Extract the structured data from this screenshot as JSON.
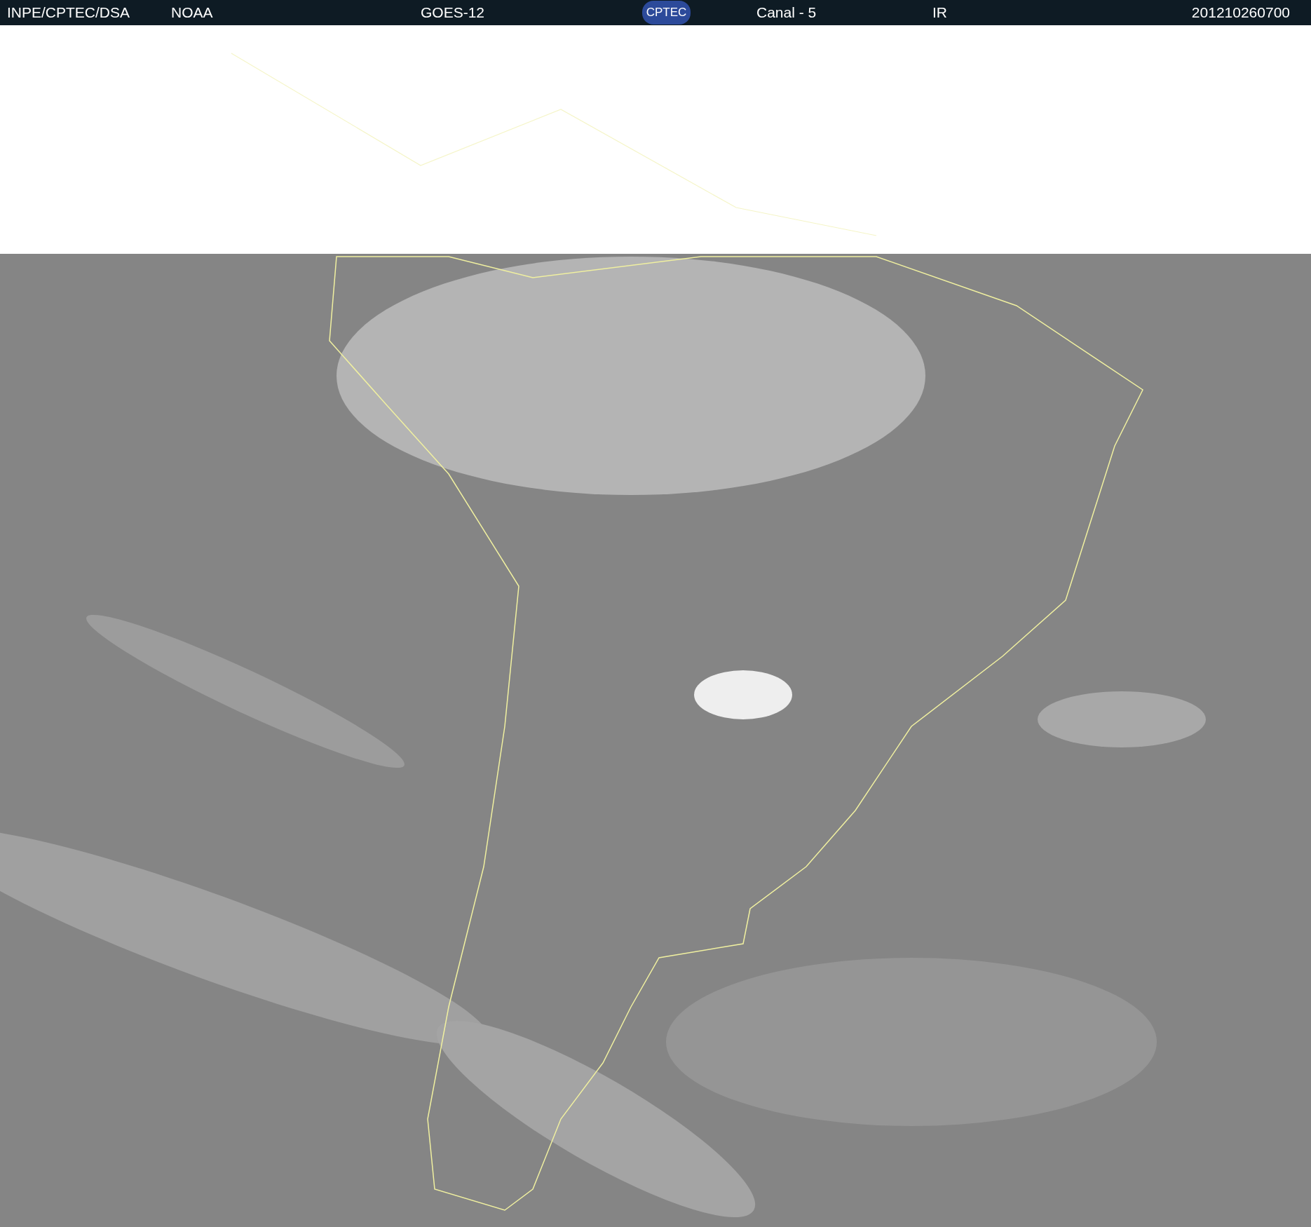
{
  "header": {
    "source": "INPE/CPTEC/DSA",
    "agency": "NOAA",
    "satellite": "GOES-12",
    "logo": "CPTEC",
    "channel": "Canal - 5",
    "band": "IR",
    "timestamp": "201210260700"
  }
}
